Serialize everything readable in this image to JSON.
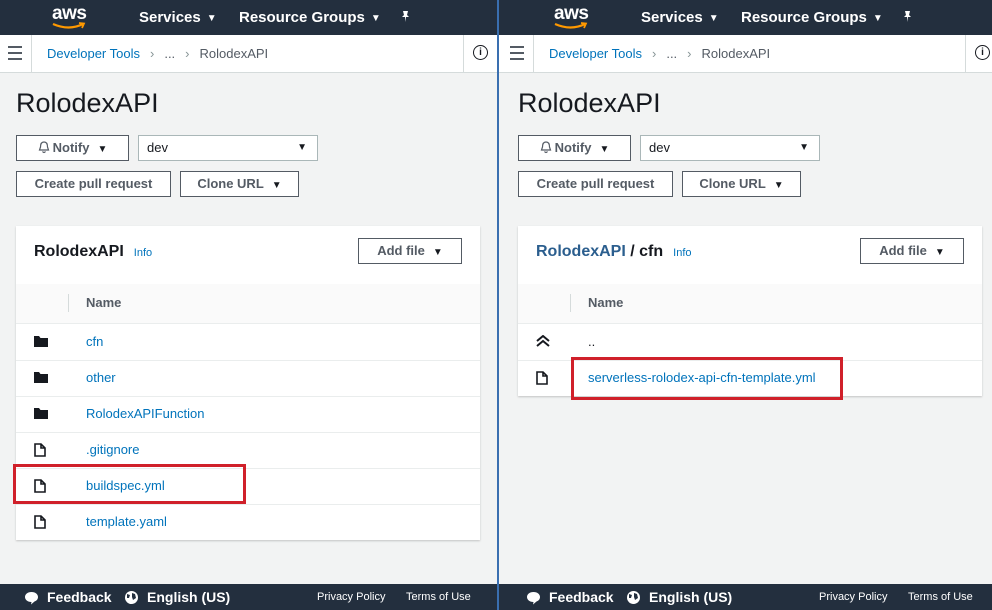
{
  "topnav": {
    "logo": "aws",
    "services": "Services",
    "resource_groups": "Resource Groups",
    "pin_icon": "pushpin-icon"
  },
  "breadcrumb": {
    "root": "Developer Tools",
    "ellipsis": "...",
    "current": "RolodexAPI"
  },
  "left": {
    "page_title": "RolodexAPI",
    "notify_label": "Notify",
    "branch": "dev",
    "create_pr_label": "Create pull request",
    "clone_url_label": "Clone URL",
    "card_title": "RolodexAPI",
    "info_label": "Info",
    "add_file_label": "Add file",
    "column_name": "Name",
    "files": [
      {
        "name": "cfn",
        "type": "folder"
      },
      {
        "name": "other",
        "type": "folder"
      },
      {
        "name": "RolodexAPIFunction",
        "type": "folder"
      },
      {
        "name": ".gitignore",
        "type": "file"
      },
      {
        "name": "buildspec.yml",
        "type": "file",
        "highlighted": true
      },
      {
        "name": "template.yaml",
        "type": "file"
      }
    ]
  },
  "right": {
    "page_title": "RolodexAPI",
    "notify_label": "Notify",
    "branch": "dev",
    "create_pr_label": "Create pull request",
    "clone_url_label": "Clone URL",
    "card_title_link": "RolodexAPI",
    "card_title_sep": " / ",
    "card_title_folder": "cfn",
    "info_label": "Info",
    "add_file_label": "Add file",
    "column_name": "Name",
    "parent_label": "..",
    "files": [
      {
        "name": "serverless-rolodex-api-cfn-template.yml",
        "type": "file",
        "highlighted": true
      }
    ]
  },
  "footer": {
    "feedback": "Feedback",
    "language": "English (US)",
    "privacy": "Privacy Policy",
    "terms": "Terms of Use"
  },
  "colors": {
    "nav_bg": "#232f3e",
    "link": "#0073bb",
    "highlight": "#d0202a",
    "divider": "#3a6fb0"
  }
}
